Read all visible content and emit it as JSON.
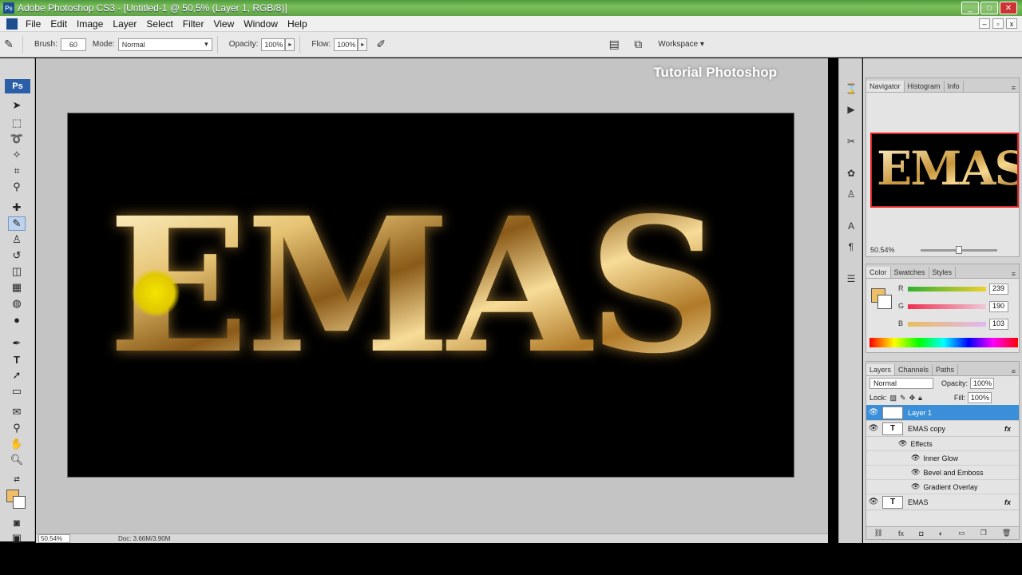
{
  "window": {
    "app_icon": "Ps",
    "title": "Adobe Photoshop CS3 - [Untitled-1 @ 50,5% (Layer 1, RGB/8)]",
    "buttons": [
      "_",
      "□",
      "✕"
    ]
  },
  "menubar": {
    "items": [
      "File",
      "Edit",
      "Image",
      "Layer",
      "Select",
      "Filter",
      "View",
      "Window",
      "Help"
    ],
    "doc_buttons": [
      "–",
      "▫",
      "x"
    ]
  },
  "options": {
    "brush_label": "Brush:",
    "brush_size": "60",
    "mode_label": "Mode:",
    "mode_value": "Normal",
    "opacity_label": "Opacity:",
    "opacity_value": "100%",
    "flow_label": "Flow:",
    "flow_value": "100%",
    "workspace_label": "Workspace ▾"
  },
  "toolbox": {
    "logo": "Ps"
  },
  "workspace": {
    "watermark": "Tutorial Photoshop",
    "canvas_text": "EMAS",
    "canvas_bg": "#000000",
    "text_color": "#c89a3c"
  },
  "status": {
    "zoom": "50.54%",
    "doc": "Doc: 3.66M/3.90M"
  },
  "navigator": {
    "tabs": [
      "Navigator",
      "Histogram",
      "Info"
    ],
    "thumb_text": "EMAS",
    "zoom": "50.54%"
  },
  "color_panel": {
    "tabs": [
      "Color",
      "Swatches",
      "Styles"
    ],
    "fg_color": "#efbe66",
    "r_label": "R",
    "r_value": "239",
    "g_label": "G",
    "g_value": "190",
    "b_label": "B",
    "b_value": "103"
  },
  "layers_panel": {
    "tabs": [
      "Layers",
      "Channels",
      "Paths"
    ],
    "blend_mode": "Normal",
    "opacity_label": "Opacity:",
    "opacity_value": "100%",
    "lock_label": "Lock:",
    "fill_label": "Fill:",
    "fill_value": "100%",
    "layers": [
      {
        "name": "Layer 1",
        "selected": true
      },
      {
        "name": "EMAS copy",
        "type": "T",
        "fx": "fx"
      },
      {
        "name": "EMAS",
        "type": "T",
        "fx": "fx"
      }
    ],
    "effects_heading": "Effects",
    "effects": [
      "Inner Glow",
      "Bevel and Emboss",
      "Gradient Overlay"
    ],
    "footer_icons": [
      "link-icon",
      "fx-icon",
      "mask-icon",
      "adjustment-icon",
      "group-icon",
      "new-layer-icon",
      "trash-icon"
    ]
  }
}
